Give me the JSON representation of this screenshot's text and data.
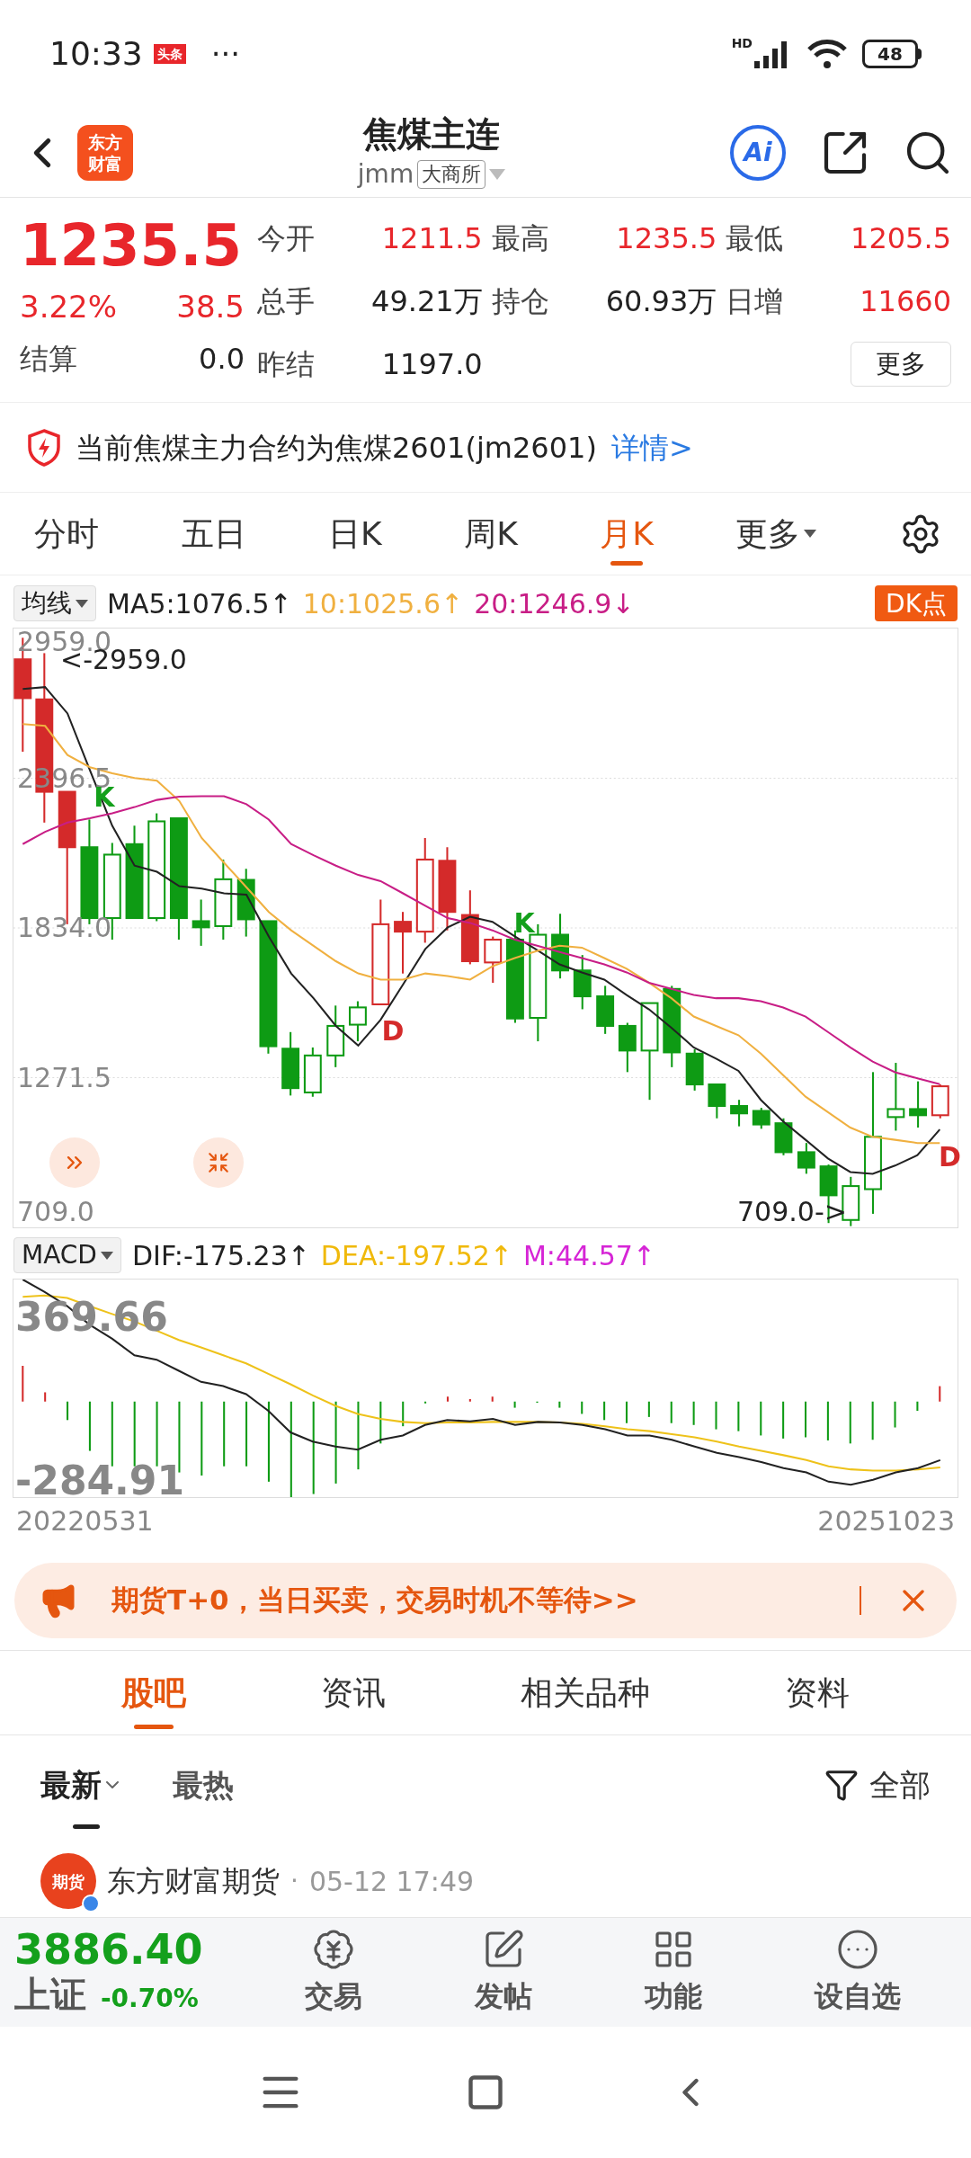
{
  "status_bar": {
    "time": "10:33",
    "badge": "头条",
    "dots": "···",
    "network": "HD",
    "battery": "48"
  },
  "header": {
    "logo": [
      "东方",
      "财富"
    ],
    "title": "焦煤主连",
    "code": "jmm",
    "exchange": "大商所",
    "ai_button": "Ai"
  },
  "quote": {
    "price": "1235.5",
    "change_pct": "3.22%",
    "change": "38.5",
    "settle_label": "结算",
    "settle_value": "0.0",
    "stats": [
      {
        "label": "今开",
        "value": "1211.5",
        "color": "#e8262b"
      },
      {
        "label": "最高",
        "value": "1235.5",
        "color": "#e8262b"
      },
      {
        "label": "最低",
        "value": "1205.5",
        "color": "#e8262b"
      },
      {
        "label": "总手",
        "value": "49.21万",
        "color": "#222222"
      },
      {
        "label": "持仓",
        "value": "60.93万",
        "color": "#222222"
      },
      {
        "label": "日增",
        "value": "11660",
        "color": "#e8262b"
      },
      {
        "label": "昨结",
        "value": "1197.0",
        "color": "#222222"
      }
    ],
    "more_button": "更多"
  },
  "notice": {
    "text": "当前焦煤主力合约为焦煤2601(jm2601)",
    "link": "详情>"
  },
  "chart_tabs": [
    {
      "label": "分时",
      "selected": false
    },
    {
      "label": "五日",
      "selected": false
    },
    {
      "label": "日K",
      "selected": false
    },
    {
      "label": "周K",
      "selected": false
    },
    {
      "label": "月K",
      "selected": true
    },
    {
      "label": "更多",
      "selected": false,
      "kind": "dropdown"
    }
  ],
  "ma_legend": {
    "selector": "均线",
    "items": [
      {
        "value": ":1076.5",
        "arrow": "↑"
      },
      {
        "value": ":1025.6",
        "arrow": "↑"
      },
      {
        "value": ":1246.9",
        "arrow": "↓"
      }
    ],
    "dk_button": "DK点"
  },
  "price_chart": {
    "chart_data": {
      "type": "line",
      "grid": true,
      "ylim": [
        709,
        2959
      ],
      "yticks": [
        {
          "value": 2959,
          "label": "2959.0"
        },
        {
          "value": 2396.5,
          "label": "2396.5"
        },
        {
          "value": 1834,
          "label": "1834.0"
        },
        {
          "value": 1271.5,
          "label": "1271.5"
        },
        {
          "value": 709,
          "label": "709.0"
        }
      ],
      "series": [
        {
          "name": "MA5",
          "color": "#222222",
          "values": [
            2732,
            2739,
            2640,
            2427,
            2218,
            2068,
            2045,
            1991,
            1982,
            1964,
            1959,
            1802,
            1663,
            1570,
            1466,
            1392,
            1489,
            1621,
            1755,
            1836,
            1876,
            1857,
            1802,
            1751,
            1697,
            1667,
            1640,
            1582,
            1528,
            1459,
            1385,
            1343,
            1297,
            1188,
            1107,
            1038,
            968,
            917,
            910,
            941,
            980,
            1077
          ]
        },
        {
          "name": "10",
          "color": "#f0b040",
          "values": [
            2600,
            2593,
            2484,
            2438,
            2415,
            2397,
            2387,
            2311,
            2172,
            2079,
            1987,
            1894,
            1825,
            1767,
            1709,
            1663,
            1640,
            1640,
            1663,
            1653,
            1640,
            1690,
            1721,
            1748,
            1767,
            1760,
            1721,
            1681,
            1628,
            1570,
            1501,
            1466,
            1431,
            1362,
            1281,
            1200,
            1142,
            1084,
            1049,
            1038,
            1026,
            1026
          ]
        },
        {
          "name": "20",
          "color": "#c81e86",
          "values": [
            2149,
            2195,
            2230,
            2246,
            2265,
            2288,
            2315,
            2327,
            2329,
            2329,
            2299,
            2241,
            2149,
            2107,
            2068,
            2033,
            2010,
            1964,
            1917,
            1871,
            1853,
            1825,
            1790,
            1767,
            1744,
            1721,
            1697,
            1667,
            1628,
            1605,
            1582,
            1570,
            1570,
            1559,
            1535,
            1501,
            1443,
            1385,
            1332,
            1292,
            1269,
            1247
          ]
        }
      ]
    },
    "marks": [
      {
        "text": "K",
        "kind": "buy"
      },
      {
        "text": "K",
        "kind": "buy"
      },
      {
        "text": "D",
        "kind": "sell"
      },
      {
        "text": "D",
        "kind": "sell"
      }
    ],
    "high_marker": "<-2959.0",
    "low_marker": "709.0->"
  },
  "macd_legend": {
    "selector": "MACD",
    "items": [
      {
        "text": "DIF:-175.23",
        "arrow": "↑",
        "color": "#222222"
      },
      {
        "text": "DEA:-197.52",
        "arrow": "↑",
        "color": "#f0b90b"
      },
      {
        "text": "M:44.57",
        "arrow": "↑",
        "color": "#d625d6"
      }
    ]
  },
  "macd_axis": [
    "369.66",
    "-284.91"
  ],
  "dates": [
    "20220531",
    "20251023"
  ],
  "promo": {
    "text": "期货T+0，当日买卖，交易时机不等待>>"
  },
  "section_tabs": [
    {
      "label": "股吧",
      "selected": true
    },
    {
      "label": "资讯",
      "selected": false
    },
    {
      "label": "相关品种",
      "selected": false
    },
    {
      "label": "资料",
      "selected": false
    }
  ],
  "sort_tabs": [
    {
      "label": "最新",
      "selected": true
    },
    {
      "label": "最热",
      "selected": false
    }
  ],
  "filter": "全部",
  "post": {
    "avatar": "期货",
    "author": "东方财富期货",
    "separator": "·",
    "time": "05-12 17:49"
  },
  "bottom_bar": {
    "index_value": "3886.40",
    "index_name": "上证",
    "index_change": "-0.70%",
    "items": [
      {
        "label": "交易",
        "kind": "trade"
      },
      {
        "label": "发帖",
        "kind": "post"
      },
      {
        "label": "功能",
        "kind": "tools"
      },
      {
        "label": "设自选",
        "kind": "watch"
      }
    ]
  }
}
